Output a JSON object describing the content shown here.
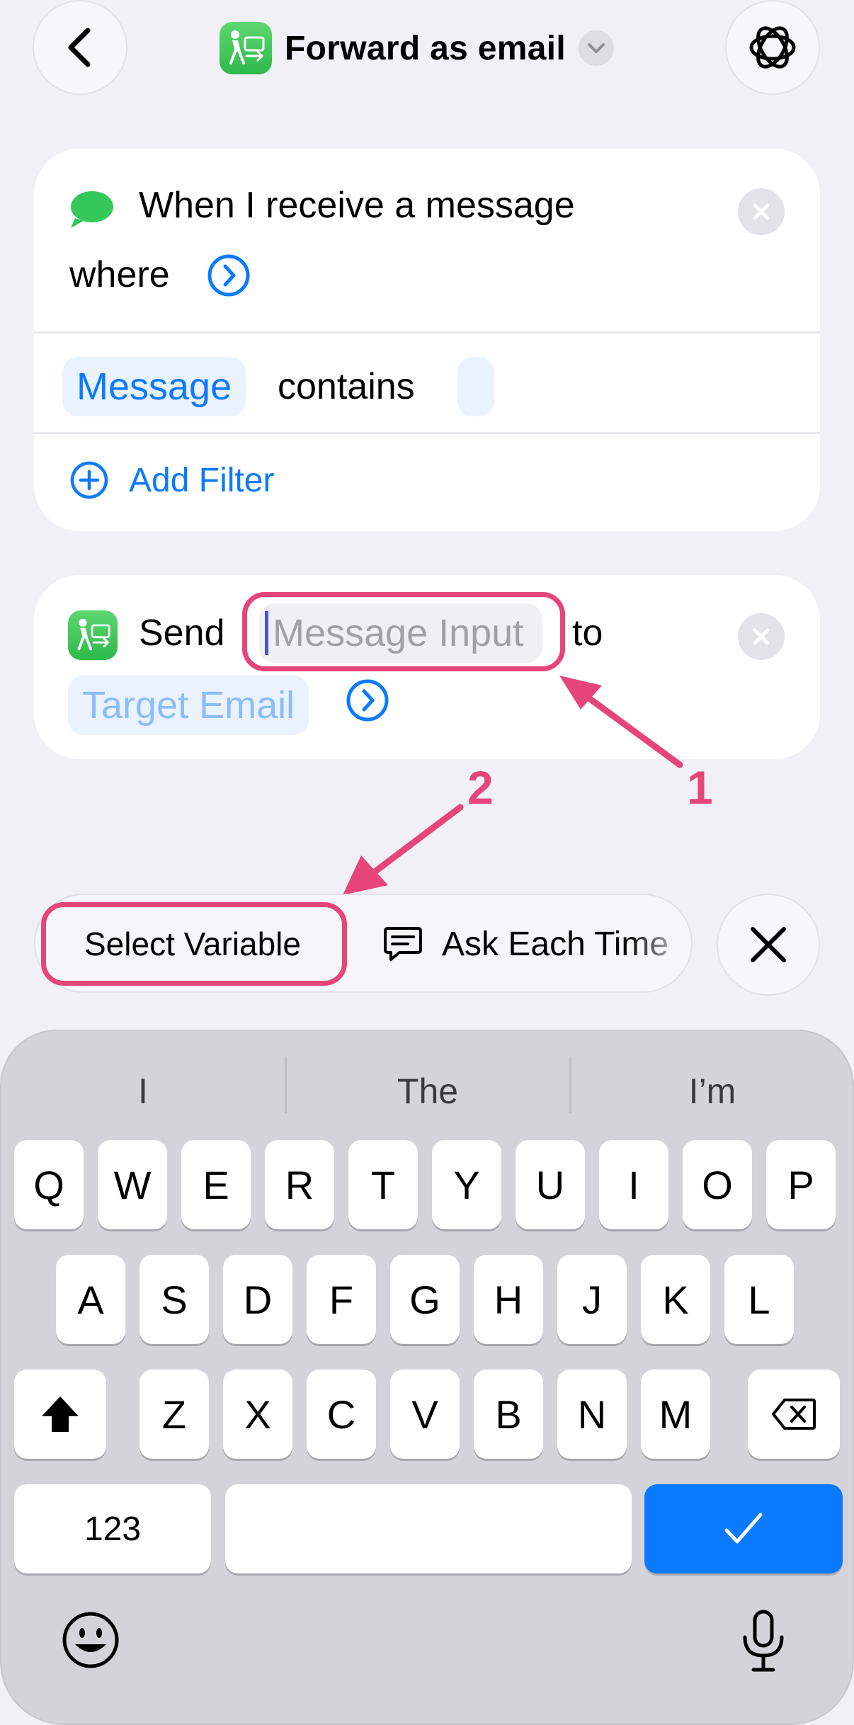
{
  "header": {
    "title": "Forward as email",
    "back_icon": "chevron-left-icon",
    "settings_icon": "flower-settings-icon",
    "app_icon": "sms-forward-app-icon"
  },
  "trigger_card": {
    "line1": "When I receive a message",
    "line2": "where",
    "filter_token": "Message",
    "filter_operator": "contains",
    "add_filter_label": "Add Filter"
  },
  "action_card": {
    "send_label": "Send",
    "message_input_placeholder": "Message Input",
    "to_label": "to",
    "target_token": "Target Email"
  },
  "annotations": {
    "num1": "1",
    "num2": "2"
  },
  "suggestions": {
    "select_variable": "Select Variable",
    "ask_each_time": "Ask Each Time"
  },
  "keyboard": {
    "predictions": [
      "I",
      "The",
      "I’m"
    ],
    "row1": [
      "Q",
      "W",
      "E",
      "R",
      "T",
      "Y",
      "U",
      "I",
      "O",
      "P"
    ],
    "row2": [
      "A",
      "S",
      "D",
      "F",
      "G",
      "H",
      "J",
      "K",
      "L"
    ],
    "row3": [
      "Z",
      "X",
      "C",
      "V",
      "B",
      "N",
      "M"
    ],
    "numbers_key": "123"
  },
  "colors": {
    "accent_blue": "#0A7AFF",
    "annotation_pink": "#E6457A",
    "message_green": "#34C759"
  }
}
